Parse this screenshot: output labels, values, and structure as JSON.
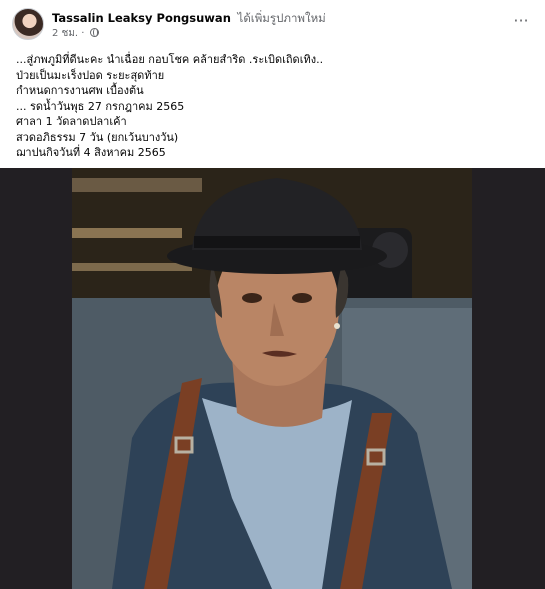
{
  "post": {
    "author": "Tassalin Leaksy Pongsuwan",
    "action": "ได้เพิ่มรูปภาพใหม่",
    "time": "2 ชม.",
    "time_separator": "·",
    "more_icon": "more-horizontal-icon",
    "privacy_icon": "globe-icon",
    "text": "...สู่ภพภูมิที่ดีนะคะ นำเฉื่อย กอบโชค คล้ายสำริด .ระเบิดเถิดเทิง..\nป่วยเป็นมะเร็งปอด ระยะสุดท้าย\nกำหนดการงานศพ เบื้องต้น\n... รดน้ำวันพุธ 27 กรกฎาคม 2565\nศาลา 1 วัดลาดปลาเค้า\nสวดอภิธรรม 7 วัน (ยกเว้นบางวัน)\nฌาปนกิจวันที่ 4 สิงหาคม 2565"
  },
  "colors": {
    "text_primary": "#050505",
    "text_secondary": "#65676b",
    "photo_background": "#221f23"
  }
}
